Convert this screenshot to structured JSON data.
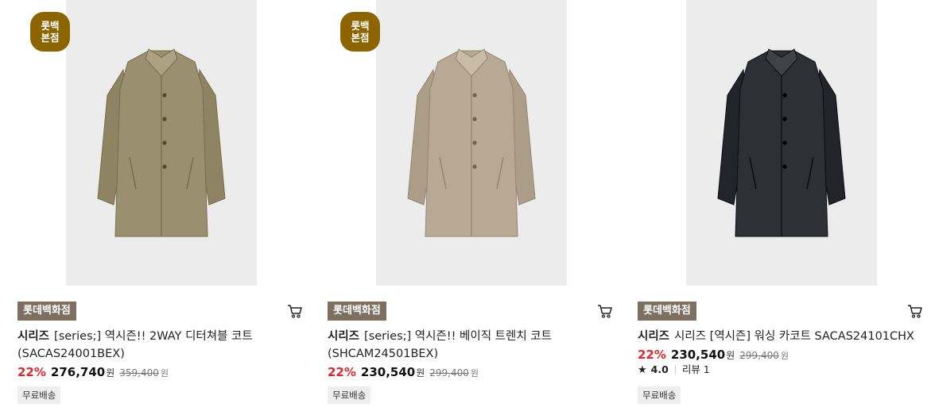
{
  "products": [
    {
      "badge": "롯백\n본점",
      "store": "롯데백화점",
      "brand": "시리즈",
      "name": "[series;] 역시즌!! 2WAY 디터쳐블 코트 (SACAS24001BEX)",
      "discount": "22%",
      "price": "276,740",
      "price_unit": "원",
      "original_price": "359,400",
      "original_unit": "원",
      "shipping": "무료배송",
      "coat_color": "#9a906f"
    },
    {
      "badge": "롯백\n본점",
      "store": "롯데백화점",
      "brand": "시리즈",
      "name": "[series;] 역시즌!! 베이직 트렌치 코트 (SHCAM24501BEX)",
      "discount": "22%",
      "price": "230,540",
      "price_unit": "원",
      "original_price": "299,400",
      "original_unit": "원",
      "shipping": "무료배송",
      "coat_color": "#b7a994"
    },
    {
      "store": "롯데백화점",
      "brand": "시리즈",
      "name": "시리즈 [역시즌] 워싱 카코트 SACAS24101CHX",
      "discount": "22%",
      "price": "230,540",
      "price_unit": "원",
      "original_price": "299,400",
      "original_unit": "원",
      "rating": "4.0",
      "review": "리뷰 1",
      "shipping": "무료배송",
      "coat_color": "#2f3035"
    }
  ],
  "colors": {
    "badge": "#8c6500",
    "store_tag": "#7d6f62",
    "discount": "#e0262b",
    "image_bg": "#ececec"
  },
  "icons": {
    "cart": "cart-icon",
    "star": "star-icon"
  }
}
